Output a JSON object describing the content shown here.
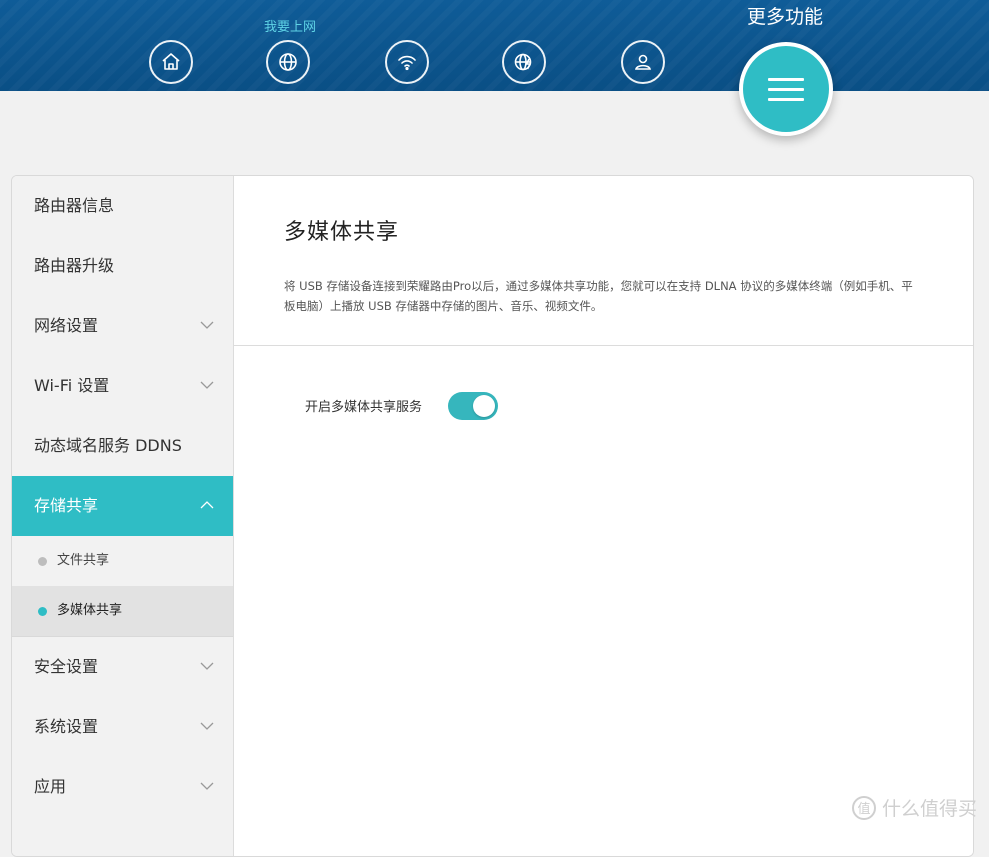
{
  "header": {
    "active_label": "我要上网",
    "more_label": "更多功能",
    "icons": [
      "home-icon",
      "globe-icon",
      "wifi-icon",
      "globe-lightning-icon",
      "user-icon",
      "menu-icon"
    ]
  },
  "sidebar": {
    "items": [
      {
        "label": "路由器信息"
      },
      {
        "label": "路由器升级"
      },
      {
        "label": "网络设置"
      },
      {
        "label": "Wi-Fi 设置"
      },
      {
        "label": "动态域名服务 DDNS"
      },
      {
        "label": "存储共享"
      },
      {
        "label": "安全设置"
      },
      {
        "label": "系统设置"
      },
      {
        "label": "应用"
      }
    ],
    "subitems": [
      {
        "label": "文件共享"
      },
      {
        "label": "多媒体共享"
      }
    ]
  },
  "main": {
    "title": "多媒体共享",
    "description": "将 USB 存储设备连接到荣耀路由Pro以后，通过多媒体共享功能，您就可以在支持 DLNA 协议的多媒体终端（例如手机、平板电脑）上播放 USB 存储器中存储的图片、音乐、视频文件。",
    "toggle_label": "开启多媒体共享服务",
    "toggle_on": true
  },
  "watermark": "什么值得买",
  "colors": {
    "accent": "#2fbdc5",
    "header_bg": "#0f5c98"
  }
}
